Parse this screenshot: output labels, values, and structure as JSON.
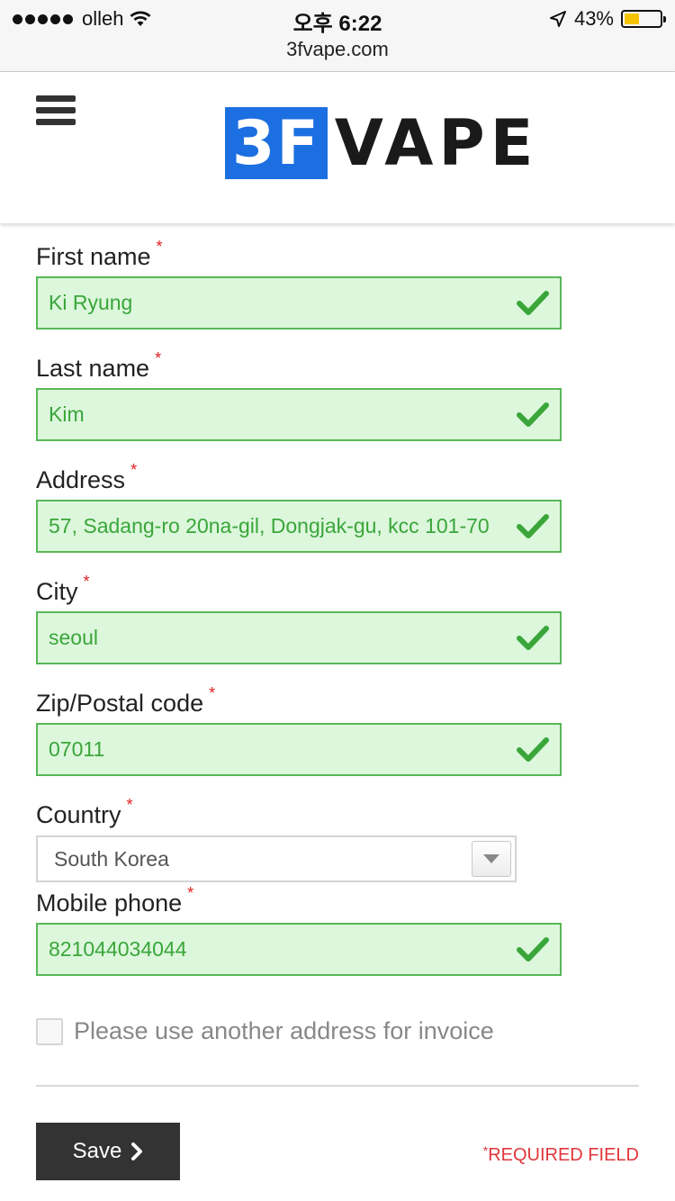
{
  "status_bar": {
    "carrier": "olleh",
    "time": "오후 6:22",
    "battery_percent": "43%",
    "battery_level": 0.43,
    "battery_color": "#f4c400"
  },
  "browser": {
    "url": "3fvape.com"
  },
  "header": {
    "menu_icon": "hamburger-menu-icon",
    "logo_box_text": "3F",
    "logo_text": "VAPE",
    "logo_color": "#1c6fe0"
  },
  "form": {
    "required_mark": "*",
    "fields": [
      {
        "label": "First name",
        "value": "Ki Ryung"
      },
      {
        "label": "Last name",
        "value": "Kim"
      },
      {
        "label": "Address",
        "value": "57, Sadang-ro 20na-gil, Dongjak-gu, kcc 101-70"
      },
      {
        "label": "City",
        "value": "seoul"
      },
      {
        "label": "Zip/Postal code",
        "value": "07011"
      },
      {
        "label": "Mobile phone",
        "value": "821044034044"
      }
    ],
    "country": {
      "label": "Country",
      "selected": "South Korea"
    },
    "invoice_checkbox": {
      "label": "Please use another address for invoice",
      "checked": false
    },
    "save_label": "Save",
    "required_note": "REQUIRED FIELD",
    "valid_color": "#3aa63a",
    "error_color": "#e02020"
  }
}
